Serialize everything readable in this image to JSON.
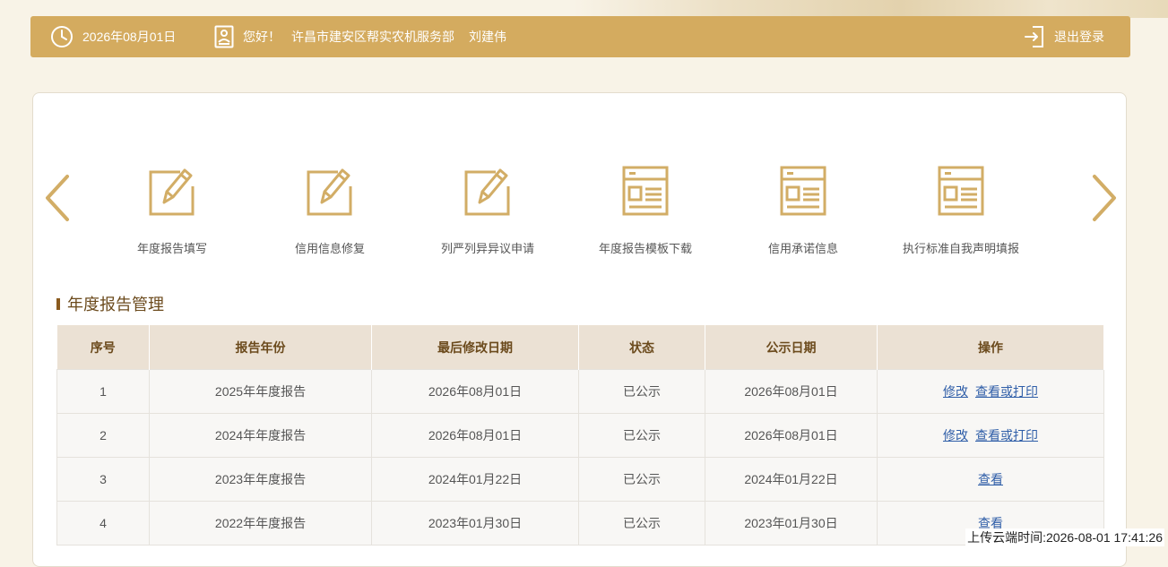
{
  "header": {
    "date": "2026年08月01日",
    "greeting": "您好！",
    "organization": "许昌市建安区帮实农机服务部",
    "username": "刘建伟",
    "logout_label": "退出登录"
  },
  "menu": {
    "items": [
      {
        "label": "年度报告填写",
        "icon": "edit-doc-icon"
      },
      {
        "label": "信用信息修复",
        "icon": "edit-doc-icon"
      },
      {
        "label": "列严列异异议申请",
        "icon": "edit-doc-icon"
      },
      {
        "label": "年度报告模板下载",
        "icon": "form-template-icon"
      },
      {
        "label": "信用承诺信息",
        "icon": "form-template-icon"
      },
      {
        "label": "执行标准自我声明填报",
        "icon": "form-template-icon"
      }
    ]
  },
  "section": {
    "title": "年度报告管理"
  },
  "table": {
    "headers": [
      "序号",
      "报告年份",
      "最后修改日期",
      "状态",
      "公示日期",
      "操作"
    ],
    "rows": [
      {
        "no": "1",
        "year": "2025年年度报告",
        "modified": "2026年08月01日",
        "status": "已公示",
        "published": "2026年08月01日",
        "actions": [
          "修改",
          "查看或打印"
        ]
      },
      {
        "no": "2",
        "year": "2024年年度报告",
        "modified": "2026年08月01日",
        "status": "已公示",
        "published": "2026年08月01日",
        "actions": [
          "修改",
          "查看或打印"
        ]
      },
      {
        "no": "3",
        "year": "2023年年度报告",
        "modified": "2024年01月22日",
        "status": "已公示",
        "published": "2024年01月22日",
        "actions": [
          "查看"
        ]
      },
      {
        "no": "4",
        "year": "2022年年度报告",
        "modified": "2023年01月30日",
        "status": "已公示",
        "published": "2023年01月30日",
        "actions": [
          "查看"
        ]
      }
    ]
  },
  "footer": {
    "upload_time": "上传云端时间:2026-08-01 17:41:26"
  },
  "colors": {
    "accent": "#d4ab5f",
    "heading": "#6b4a1c",
    "link": "#2f5ea8",
    "table_header_bg": "#ebe1d4"
  }
}
